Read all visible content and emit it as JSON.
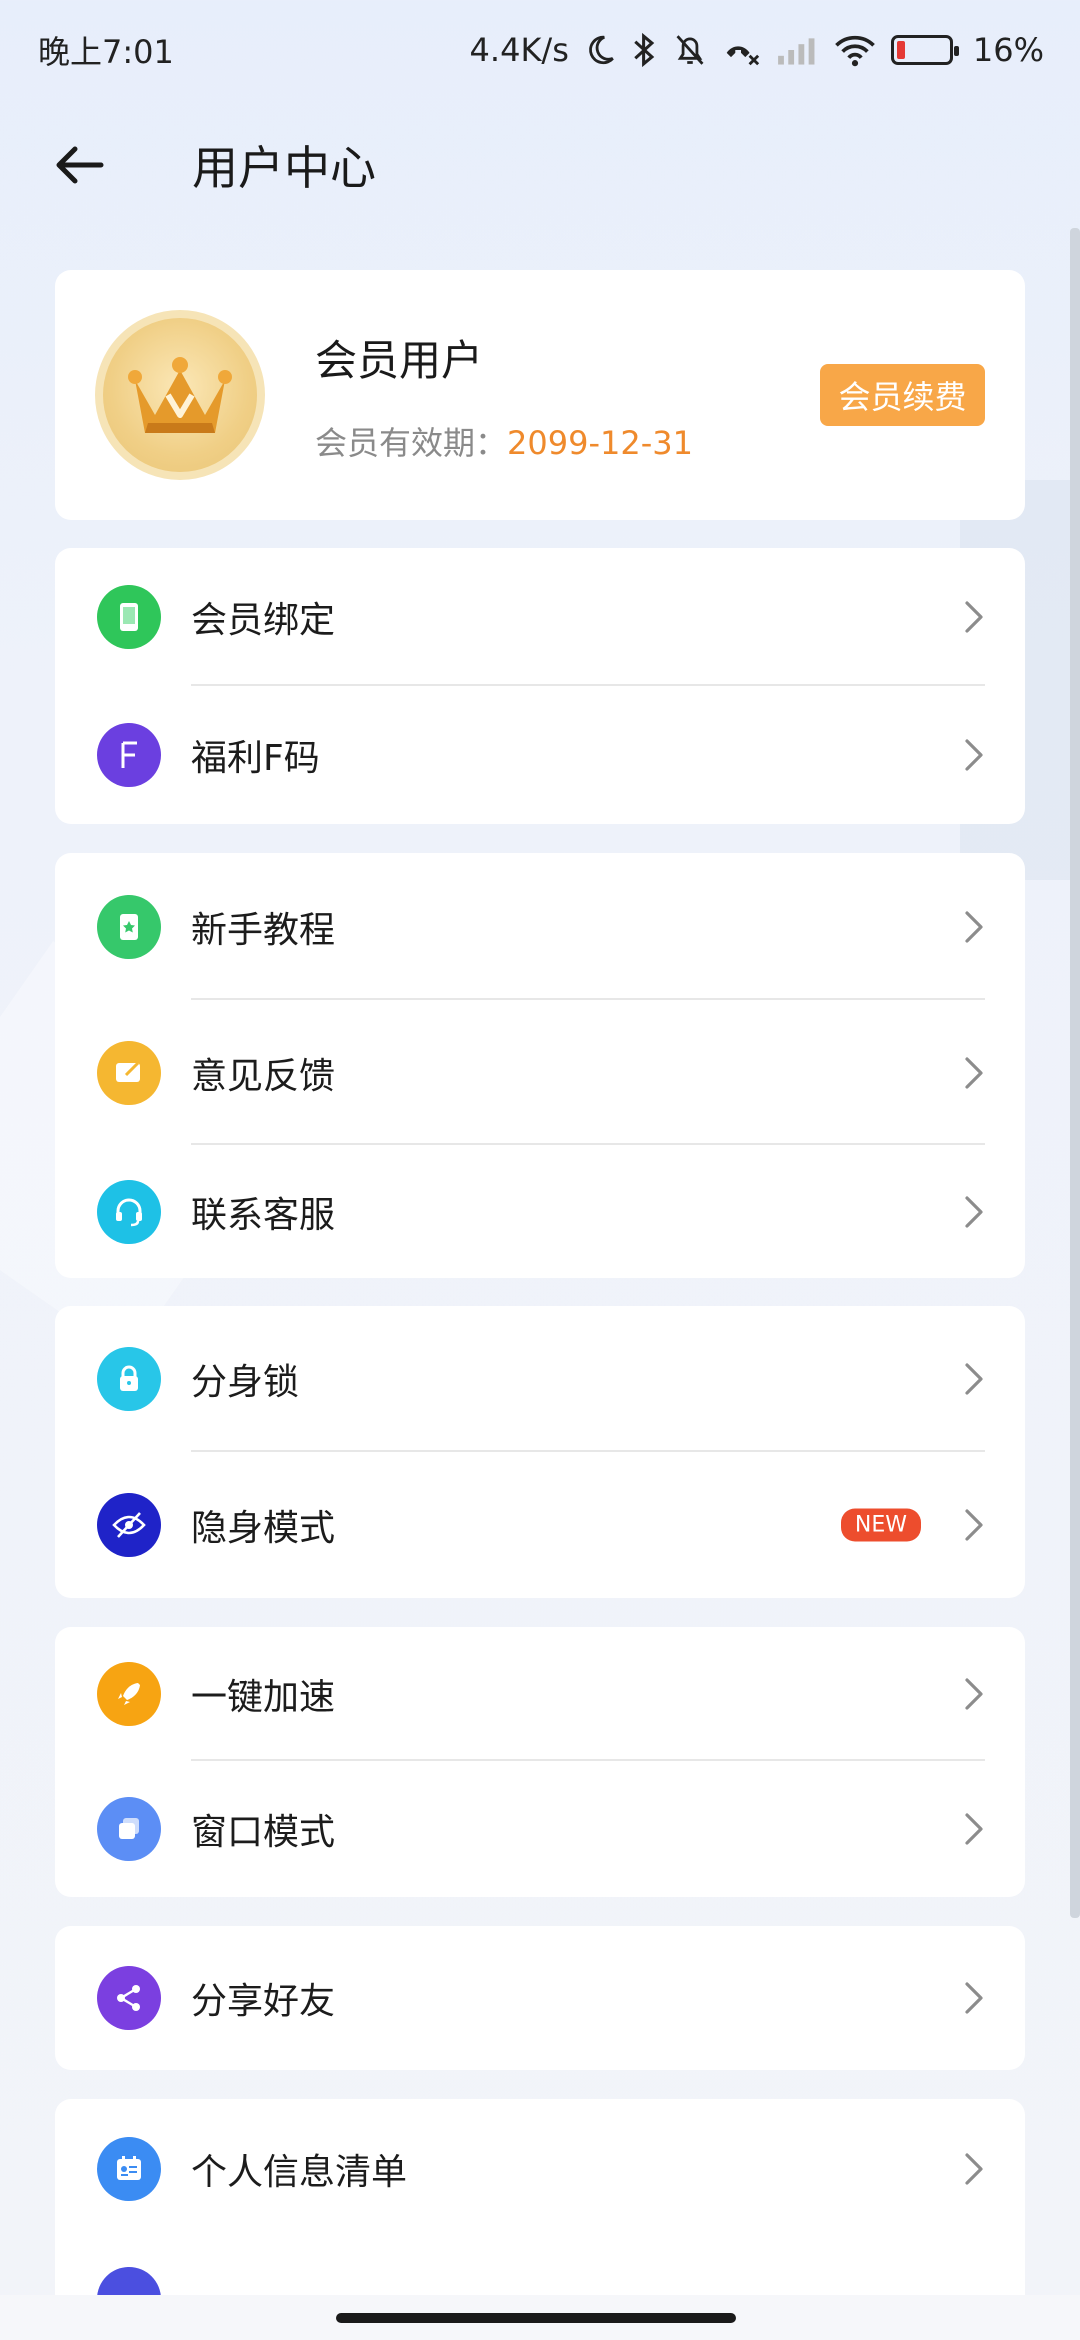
{
  "status_bar": {
    "time": "晚上7:01",
    "net_speed": "4.4K/s",
    "battery": "16%",
    "battery_level": 0.16
  },
  "header": {
    "title": "用户中心"
  },
  "member": {
    "name": "会员用户",
    "expiry_label": "会员有效期：",
    "expiry_date": "2099-12-31",
    "renew_label": "会员续费"
  },
  "groups": [
    {
      "items": [
        {
          "label": "会员绑定",
          "icon": "phone-icon",
          "color": "#2fc65a"
        },
        {
          "label": "福利F码",
          "icon": "f-letter-icon",
          "color": "#6b3fe0"
        }
      ]
    },
    {
      "items": [
        {
          "label": "新手教程",
          "icon": "book-star-icon",
          "color": "#36c86b"
        },
        {
          "label": "意见反馈",
          "icon": "feedback-icon",
          "color": "#f5b731"
        },
        {
          "label": "联系客服",
          "icon": "headset-icon",
          "color": "#1ec1e6"
        }
      ]
    },
    {
      "items": [
        {
          "label": "分身锁",
          "icon": "lock-icon",
          "color": "#28c6e8"
        },
        {
          "label": "隐身模式",
          "icon": "eye-off-icon",
          "color": "#1f23c8",
          "badge": "NEW"
        }
      ]
    },
    {
      "items": [
        {
          "label": "一键加速",
          "icon": "rocket-icon",
          "color": "#f7a412"
        },
        {
          "label": "窗口模式",
          "icon": "windows-icon",
          "color": "#5c8ef5"
        }
      ]
    },
    {
      "items": [
        {
          "label": "分享好友",
          "icon": "share-icon",
          "color": "#7b3fe0"
        }
      ]
    },
    {
      "items": [
        {
          "label": "个人信息清单",
          "icon": "id-card-icon",
          "color": "#3b8cf3"
        }
      ]
    }
  ]
}
